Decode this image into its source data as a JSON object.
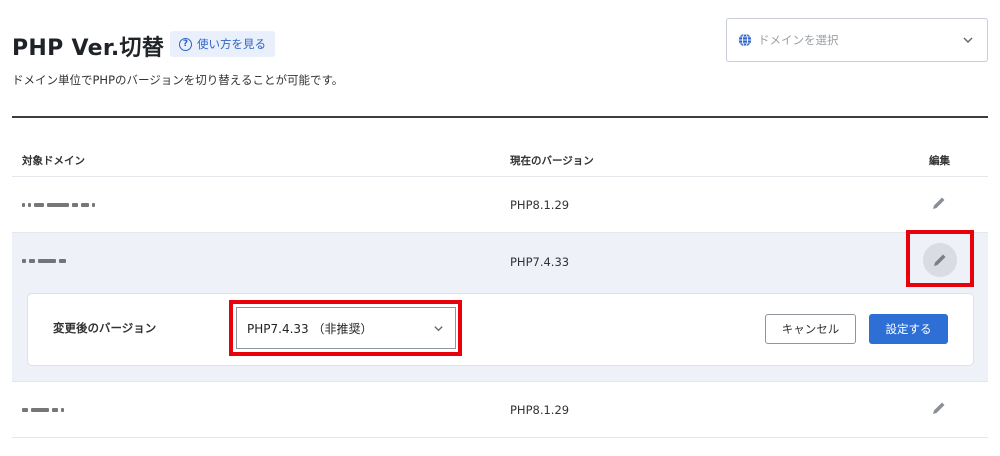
{
  "header": {
    "title": "PHP Ver.切替",
    "howto_label": "使い方を見る",
    "description": "ドメイン単位でPHPのバージョンを切り替えることが可能です。"
  },
  "domain_select": {
    "placeholder": "ドメインを選択",
    "icon": "globe-icon"
  },
  "table": {
    "columns": [
      "対象ドメイン",
      "現在のバージョン",
      "編集"
    ],
    "rows": [
      {
        "domain": "",
        "version": "PHP8.1.29"
      },
      {
        "domain": "",
        "version": "PHP7.4.33"
      },
      {
        "domain": "",
        "version": "PHP8.1.29"
      }
    ]
  },
  "edit_panel": {
    "label": "変更後のバージョン",
    "selected_version": "PHP7.4.33 （非推奨）",
    "cancel_label": "キャンセル",
    "save_label": "設定する"
  },
  "colors": {
    "accent": "#2e6fd6",
    "highlight_box": "#e8000b",
    "active_row": "#eef1f8"
  }
}
